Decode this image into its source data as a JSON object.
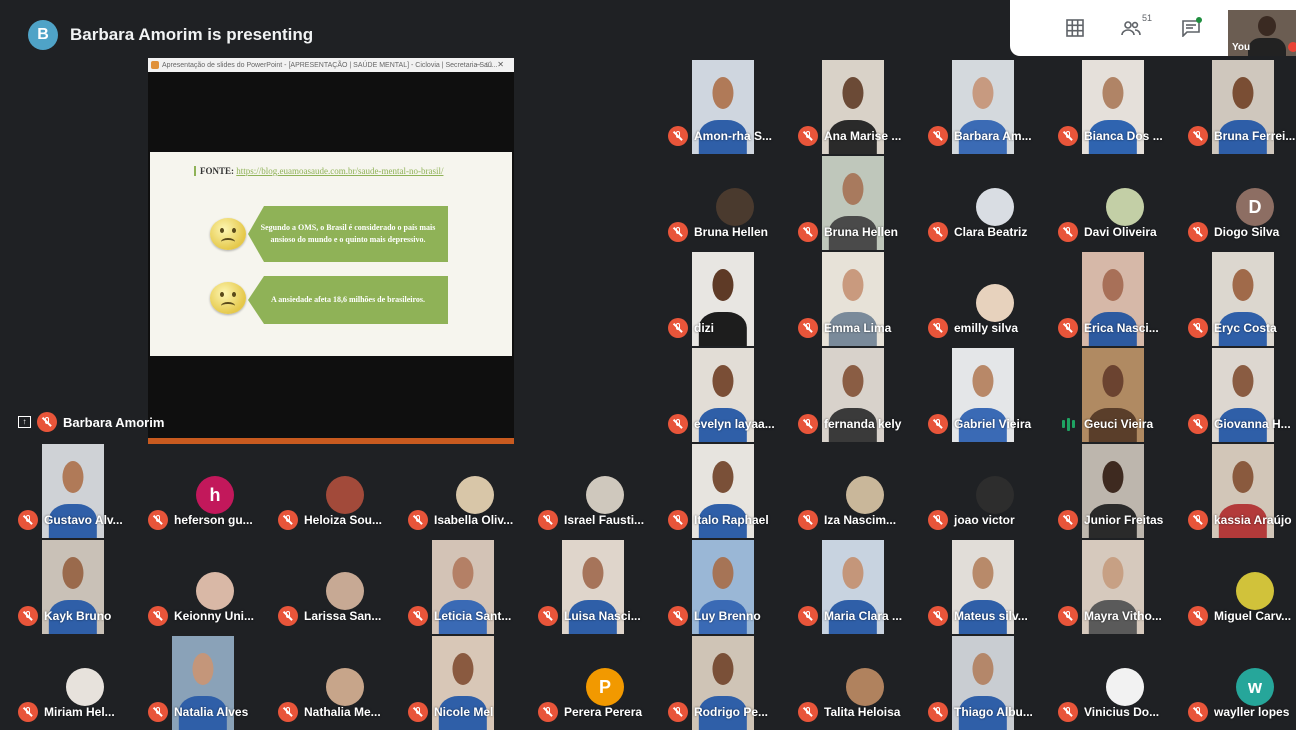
{
  "meeting": {
    "presenter_initial": "B",
    "presenting_text": "Barbara Amorim is presenting",
    "presenter_tile_name": "Barbara Amorim",
    "people_count": "51",
    "self_label": "You"
  },
  "shared_screen": {
    "window_title": "Apresentação de slides do PowerPoint - [APRESENTAÇÃO | SAÚDE MENTAL] - Ciclovia | Secretaria Saú...",
    "fonte_label": "FONTE:",
    "fonte_url": "https://blog.euamoasaude.com.br/saude-mental-no-brasil/",
    "card1": "Segundo a OMS, o Brasil é considerado o país mais ansioso do mundo e o quinto mais depressivo.",
    "card2": "A ansiedade afeta 18,6 milhões de brasileiros."
  },
  "colors": {
    "background": "#1f2124",
    "muted_icon": "#e8553a",
    "speaking_indicator": "#1ea362",
    "slide_accent": "#8fb257"
  },
  "participants": [
    {
      "name": "Amon-rha S...",
      "type": "photo",
      "bg": "#cfd6df",
      "skin": "#b07a58",
      "shirt": "#2f5fa8"
    },
    {
      "name": "Ana Marise ...",
      "type": "photo",
      "bg": "#d9d2c8",
      "skin": "#6b4a36",
      "shirt": "#2a2a2a"
    },
    {
      "name": "Barbara Am...",
      "type": "photo",
      "bg": "#d4d9dd",
      "skin": "#c79a80",
      "shirt": "#3b6bb5"
    },
    {
      "name": "Bianca Dos ...",
      "type": "photo",
      "bg": "#e5e0da",
      "skin": "#b08466",
      "shirt": "#2f64b0"
    },
    {
      "name": "Bruna Ferrei...",
      "type": "photo",
      "bg": "#cfc7bd",
      "skin": "#7a4e34",
      "shirt": "#2e5ea8"
    },
    {
      "name": "Bruna Hellen",
      "type": "avatar",
      "bg": "#4a3a2e"
    },
    {
      "name": "Bruna Hellen",
      "type": "photo",
      "bg": "#bfc7bb",
      "skin": "#a87a5e",
      "shirt": "#4a4a4a"
    },
    {
      "name": "Clara Beatriz",
      "type": "avatar",
      "bg": "#d9dde3"
    },
    {
      "name": "Davi Oliveira",
      "type": "avatar",
      "bg": "#c3cfa6"
    },
    {
      "name": "Diogo Silva",
      "type": "letter",
      "letter": "D",
      "bg": "#8d6e63"
    },
    {
      "name": "dizi",
      "type": "photo",
      "bg": "#e8e6e2",
      "skin": "#5e3a26",
      "shirt": "#1d1d1d"
    },
    {
      "name": "Emma Lima",
      "type": "photo",
      "bg": "#e7e2d8",
      "skin": "#c99a7e",
      "shirt": "#7a8a9a"
    },
    {
      "name": "emilly silva",
      "type": "avatar",
      "bg": "#e7d2bd"
    },
    {
      "name": "Erica Nasci...",
      "type": "photo",
      "bg": "#d6b8a8",
      "skin": "#a87058",
      "shirt": "#2d5aa0"
    },
    {
      "name": "Eryc Costa",
      "type": "photo",
      "bg": "#dcd7cf",
      "skin": "#a06a4a",
      "shirt": "#2f5fa8"
    },
    {
      "name": "evelyn layaa...",
      "type": "photo",
      "bg": "#e2ddd6",
      "skin": "#7a4e36",
      "shirt": "#2f5fa8"
    },
    {
      "name": "fernanda kely",
      "type": "photo",
      "bg": "#d8d2cb",
      "skin": "#8a5d44",
      "shirt": "#3a3a3a"
    },
    {
      "name": "Gabriel Vieira",
      "type": "photo",
      "bg": "#e4e6e8",
      "skin": "#b88868",
      "shirt": "#3a6ab5"
    },
    {
      "name": "Geuci Vieira",
      "type": "photo",
      "bg": "#b08a62",
      "skin": "#6b4330",
      "shirt": "#5a3e2a",
      "speaking": true
    },
    {
      "name": "Giovanna H...",
      "type": "photo",
      "bg": "#ddd7d0",
      "skin": "#8a5c42",
      "shirt": "#2f5fa8"
    },
    {
      "name": "Gustavo Alv...",
      "type": "photo",
      "bg": "#cfd2d6",
      "skin": "#b07a58",
      "shirt": "#2f5fa8"
    },
    {
      "name": "heferson gu...",
      "type": "letter",
      "letter": "h",
      "bg": "#c2185b"
    },
    {
      "name": "Heloiza Sou...",
      "type": "avatar",
      "bg": "#a24a3a"
    },
    {
      "name": "Isabella Oliv...",
      "type": "avatar",
      "bg": "#d8c6a8"
    },
    {
      "name": "Israel Fausti...",
      "type": "avatar",
      "bg": "#cfc8bd"
    },
    {
      "name": "Italo Raphael",
      "type": "photo",
      "bg": "#e7e4df",
      "skin": "#7a5038",
      "shirt": "#2f5fa8"
    },
    {
      "name": "Iza Nascim...",
      "type": "avatar",
      "bg": "#c9b79a"
    },
    {
      "name": "joao victor",
      "type": "avatar",
      "bg": "#2d2d2d"
    },
    {
      "name": "Junior Freitas",
      "type": "photo",
      "bg": "#bdb6ad",
      "skin": "#3e2a20",
      "shirt": "#2a2a2a"
    },
    {
      "name": "kassia Araújo",
      "type": "photo",
      "bg": "#d2c6b8",
      "skin": "#8a5a3e",
      "shirt": "#b33a3a"
    },
    {
      "name": "Kayk Bruno",
      "type": "photo",
      "bg": "#c9c1b7",
      "skin": "#9a6a4c",
      "shirt": "#2f5fa8"
    },
    {
      "name": "Keionny Uni...",
      "type": "avatar",
      "bg": "#d9b8a6"
    },
    {
      "name": "Larissa San...",
      "type": "avatar",
      "bg": "#c7a994"
    },
    {
      "name": "Leticia Sant...",
      "type": "photo",
      "bg": "#d3c3b6",
      "skin": "#b48066",
      "shirt": "#3a6ab5"
    },
    {
      "name": "Luisa Nasci...",
      "type": "photo",
      "bg": "#dfd5cb",
      "skin": "#a6745a",
      "shirt": "#2f5fa8"
    },
    {
      "name": "Luy Brenno",
      "type": "photo",
      "bg": "#9ab7d6",
      "skin": "#a67456",
      "shirt": "#3a6ab5"
    },
    {
      "name": "Maria Clara ...",
      "type": "photo",
      "bg": "#c8d3e0",
      "skin": "#c4967a",
      "shirt": "#2f5fa8"
    },
    {
      "name": "Mateus silv...",
      "type": "photo",
      "bg": "#e1ddd8",
      "skin": "#b88a6a",
      "shirt": "#2f5fa8"
    },
    {
      "name": "Mayra Vitho...",
      "type": "photo",
      "bg": "#d6c9bd",
      "skin": "#c7a084",
      "shirt": "#5a5a5a"
    },
    {
      "name": "Miguel Carv...",
      "type": "avatar",
      "bg": "#d1c23a"
    },
    {
      "name": "Miriam Hel...",
      "type": "avatar",
      "bg": "#e7e2dc"
    },
    {
      "name": "Natalia Alves",
      "type": "photo",
      "bg": "#8aa2b8",
      "skin": "#c4967a",
      "shirt": "#2f5fa8"
    },
    {
      "name": "Nathalia Me...",
      "type": "avatar",
      "bg": "#c7a58a"
    },
    {
      "name": "Nicole Mel",
      "type": "photo",
      "bg": "#d8c7b7",
      "skin": "#8a5a40",
      "shirt": "#2f5fa8"
    },
    {
      "name": "Perera Perera",
      "type": "letter",
      "letter": "P",
      "bg": "#f29900"
    },
    {
      "name": "Rodrigo Pe...",
      "type": "photo",
      "bg": "#cfc4b6",
      "skin": "#7a5038",
      "shirt": "#2f5fa8"
    },
    {
      "name": "Talita Heloisa",
      "type": "avatar",
      "bg": "#b0825e"
    },
    {
      "name": "Thiago Albu...",
      "type": "photo",
      "bg": "#c9cdd2",
      "skin": "#b4876a",
      "shirt": "#2f5fa8"
    },
    {
      "name": "Vinicius Do...",
      "type": "avatar",
      "bg": "#f2f2f2"
    },
    {
      "name": "wayller lopes",
      "type": "letter",
      "letter": "w",
      "bg": "#26a69a"
    }
  ]
}
